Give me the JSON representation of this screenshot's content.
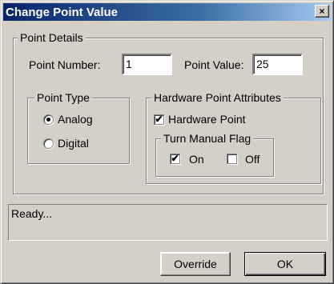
{
  "window": {
    "title": "Change Point Value",
    "close_glyph": "×"
  },
  "point_details": {
    "legend": "Point Details",
    "number_label": "Point Number:",
    "number_value": "1",
    "value_label": "Point Value:",
    "value_value": "25"
  },
  "point_type": {
    "legend": "Point Type",
    "options": [
      {
        "label": "Analog",
        "selected": true
      },
      {
        "label": "Digital",
        "selected": false
      }
    ]
  },
  "hardware": {
    "legend": "Hardware Point Attributes",
    "hardware_point_label": "Hardware Point",
    "hardware_point_checked": true,
    "manual_flag": {
      "legend": "Turn Manual Flag",
      "on_label": "On",
      "on_checked": true,
      "off_label": "Off",
      "off_checked": false
    }
  },
  "status_text": "Ready...",
  "buttons": {
    "override": "Override",
    "ok": "OK"
  },
  "check_glyph": "✔"
}
